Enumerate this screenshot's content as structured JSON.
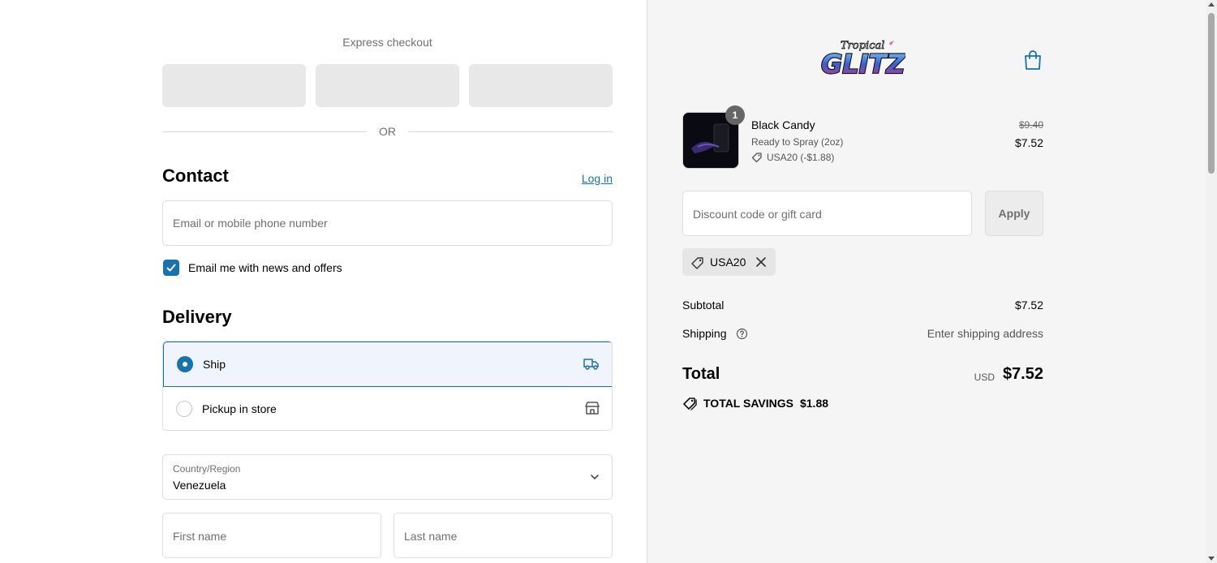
{
  "express": {
    "label": "Express checkout",
    "or_text": "OR"
  },
  "contact": {
    "title": "Contact",
    "login_link": "Log in",
    "email_placeholder": "Email or mobile phone number",
    "newsletter_label": "Email me with news and offers",
    "newsletter_checked": true
  },
  "delivery": {
    "title": "Delivery",
    "options": [
      {
        "label": "Ship",
        "selected": true,
        "icon": "truck-icon"
      },
      {
        "label": "Pickup in store",
        "selected": false,
        "icon": "store-icon"
      }
    ],
    "country_label": "Country/Region",
    "country_value": "Venezuela",
    "first_name_placeholder": "First name",
    "last_name_placeholder": "Last name"
  },
  "store": {
    "logo_top": "Tropical",
    "logo_main": "GLITZ"
  },
  "cart": {
    "item": {
      "quantity": "1",
      "name": "Black Candy",
      "variant": "Ready to Spray (2oz)",
      "discount": "USA20 (-$1.88)",
      "original_price": "$9.40",
      "price": "$7.52"
    },
    "discount_placeholder": "Discount code or gift card",
    "apply_label": "Apply",
    "applied_code": "USA20"
  },
  "summary": {
    "subtotal_label": "Subtotal",
    "subtotal_value": "$7.52",
    "shipping_label": "Shipping",
    "shipping_value": "Enter shipping address",
    "total_label": "Total",
    "currency": "USD",
    "total_value": "$7.52",
    "savings_label": "TOTAL SAVINGS",
    "savings_value": "$1.88"
  },
  "colors": {
    "accent": "#1773b0",
    "selected_bg": "#f0f5fd",
    "summary_bg": "#f5f5f5"
  }
}
